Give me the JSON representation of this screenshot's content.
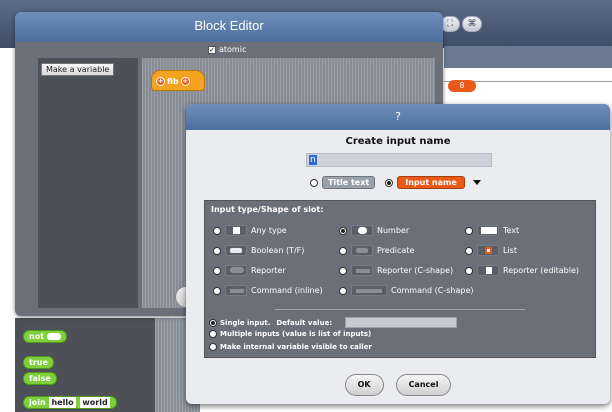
{
  "block_editor": {
    "title": "Block Editor",
    "atomic_label": "atomic",
    "atomic_checked": true,
    "make_variable_button": "Make a variable",
    "hat_block_label": "fib",
    "bg_value": "8"
  },
  "background_palette": {
    "not_block": "not",
    "true_block": "true",
    "false_block": "false",
    "join_block": "join",
    "join_arg1": "hello",
    "join_arg2": "world"
  },
  "dialog": {
    "title": "?",
    "heading": "Create input name",
    "name_value": "n",
    "title_text_label": "Title text",
    "input_name_label": "Input name",
    "selected_mode": "Input name",
    "types_title": "Input type/Shape of slot:",
    "slot_types": [
      {
        "label": "Any type",
        "icon": "rect-slot-icon",
        "selected": false
      },
      {
        "label": "Number",
        "icon": "round-slot-icon",
        "selected": true
      },
      {
        "label": "Text",
        "icon": "text-slot-icon",
        "selected": false
      },
      {
        "label": "Boolean (T/F)",
        "icon": "boolean-slot-icon",
        "selected": false
      },
      {
        "label": "Predicate",
        "icon": "predicate-slot-icon",
        "selected": false
      },
      {
        "label": "List",
        "icon": "list-slot-icon",
        "selected": false
      },
      {
        "label": "Reporter",
        "icon": "reporter-slot-icon",
        "selected": false
      },
      {
        "label": "Reporter (C-shape)",
        "icon": "reporter-cshape-icon",
        "selected": false
      },
      {
        "label": "Reporter (editable)",
        "icon": "reporter-editable-icon",
        "selected": false
      },
      {
        "label": "Command (inline)",
        "icon": "command-inline-icon",
        "selected": false
      },
      {
        "label": "Command (C-shape)",
        "icon": "command-cshape-icon",
        "selected": false
      }
    ],
    "single_input_label": "Single input.",
    "default_value_label": "Default value:",
    "default_value": "",
    "multiple_inputs_label": "Multiple inputs (value is list of inputs)",
    "make_internal_label": "Make internal variable visible to caller",
    "ok_button": "OK",
    "cancel_button": "Cancel"
  },
  "colors": {
    "title_bar": "#5a7eac",
    "orange_accent": "#e8591a",
    "hat_block": "#f3a31f",
    "operator_green": "#7fce3c"
  }
}
